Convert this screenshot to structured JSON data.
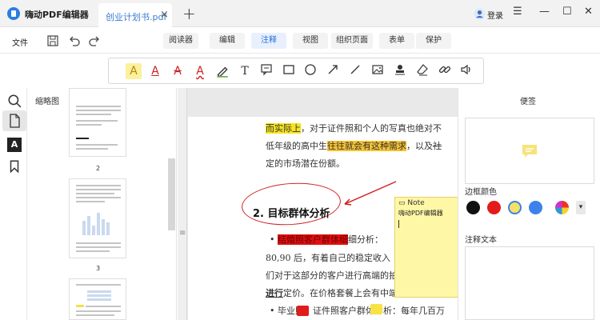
{
  "app": {
    "title": "嗨动PDF编辑器",
    "colors": {
      "accent": "#2a7de1",
      "active_tab_text": "#2a6fd6",
      "note_bg": "#fef7a5"
    }
  },
  "tabs": [
    {
      "label": "创业计划书.pdf",
      "close": "×"
    }
  ],
  "new_tab": "+",
  "user": {
    "login": "登录"
  },
  "window": {
    "menu": "☰",
    "minimize": "—",
    "maximize": "☐",
    "close": "✕"
  },
  "menubar": {
    "file": "文件",
    "tabs": [
      {
        "label": "阅读器",
        "active": false
      },
      {
        "label": "编辑",
        "active": false
      },
      {
        "label": "注释",
        "active": true
      },
      {
        "label": "视图",
        "active": false
      },
      {
        "label": "组织页面",
        "active": false
      },
      {
        "label": "表单",
        "active": false
      },
      {
        "label": "保护",
        "active": false
      }
    ]
  },
  "annot_tools": [
    "highlight-icon",
    "underline-icon",
    "strikethrough-icon",
    "squiggly-icon",
    "pen-icon",
    "text-icon",
    "comment-icon",
    "rectangle-icon",
    "circle-icon",
    "arrow-icon",
    "line-icon",
    "image-icon",
    "stamp-icon",
    "eraser-icon",
    "link-icon",
    "audio-icon"
  ],
  "thumbnails": {
    "title": "缩略图",
    "pages": [
      "2",
      "3"
    ]
  },
  "document": {
    "lines": {
      "l1_hl": "而实际上",
      "l1_rest": "，对于证件照和个人的写真也绝对不",
      "l2_a": "低年级的高中生",
      "l2_hl": "往往就会有这种需求",
      "l2_b": "，以及",
      "l2_strike": "社",
      "l3": "定的市场潜在份额。",
      "heading": "2. 目标群体分析",
      "l5_bullet": "•",
      "l5_hl": "结婚照客户群体细",
      "l5_rest": "细分析：",
      "l6": "80,90 后，有着自己的稳定收入",
      "l7": "们对于这部分的客户进行高端的拍摄定制，制",
      "l8_bold": "进行",
      "l8_rest": "定价。在价格套餐上会有中端和高端供客户",
      "l9": "• 毕业照、证件照客户群体分析：每年几百万"
    },
    "note": {
      "title": "Note",
      "author": "嗨动PDF编辑器"
    }
  },
  "right_panel": {
    "title": "便签",
    "border_color_label": "边框颜色",
    "swatches": [
      "#111111",
      "#e31b1b",
      "#f6e06a",
      "#3c82e8",
      "#ee2a2a"
    ],
    "text_label": "注释文本"
  }
}
